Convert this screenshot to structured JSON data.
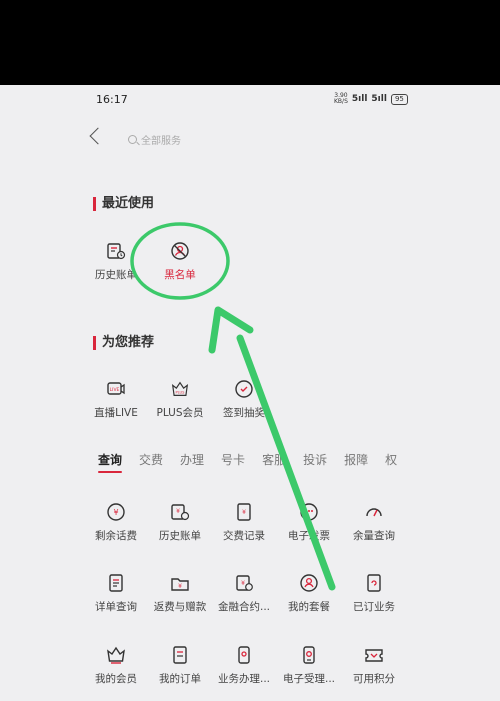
{
  "status": {
    "time": "16:17",
    "speed_value": "3.90",
    "speed_unit": "KB/S",
    "signal1": "5ıll",
    "signal2": "5ıll",
    "battery": "95"
  },
  "search": {
    "placeholder": "全部服务"
  },
  "recent": {
    "title": "最近使用",
    "items": [
      {
        "label": "历史账单",
        "icon": "bill-history-icon"
      },
      {
        "label": "黑名单",
        "icon": "blacklist-icon"
      }
    ]
  },
  "recommend": {
    "title": "为您推荐",
    "items": [
      {
        "label": "直播LIVE",
        "icon": "live-icon"
      },
      {
        "label": "PLUS会员",
        "icon": "plus-crown-icon",
        "badge": "PLUS"
      },
      {
        "label": "签到抽奖",
        "icon": "checkin-icon"
      }
    ]
  },
  "tabs": [
    "查询",
    "交费",
    "办理",
    "号卡",
    "客服",
    "投诉",
    "报障",
    "权"
  ],
  "grid": [
    {
      "label": "剩余话费",
      "icon": "balance-icon"
    },
    {
      "label": "历史账单",
      "icon": "bill-history-icon"
    },
    {
      "label": "交费记录",
      "icon": "payment-record-icon"
    },
    {
      "label": "电子发票",
      "icon": "invoice-icon"
    },
    {
      "label": "余量查询",
      "icon": "data-usage-icon"
    },
    {
      "label": "详单查询",
      "icon": "detail-list-icon"
    },
    {
      "label": "返费与赠款",
      "icon": "rebate-icon"
    },
    {
      "label": "金融合约...",
      "icon": "finance-contract-icon"
    },
    {
      "label": "我的套餐",
      "icon": "my-plan-icon"
    },
    {
      "label": "已订业务",
      "icon": "subscribed-icon"
    },
    {
      "label": "我的会员",
      "icon": "member-crown-icon"
    },
    {
      "label": "我的订单",
      "icon": "orders-icon"
    },
    {
      "label": "业务办理...",
      "icon": "business-icon"
    },
    {
      "label": "电子受理...",
      "icon": "e-acceptance-icon"
    },
    {
      "label": "可用积分",
      "icon": "points-icon"
    }
  ],
  "colors": {
    "accent": "#d9263c",
    "annotation": "#3cc96a",
    "background": "#efeff1"
  }
}
